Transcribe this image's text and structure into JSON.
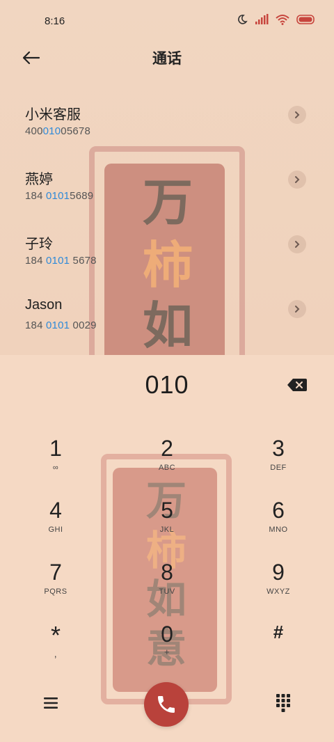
{
  "status_bar": {
    "time": "8:16",
    "icons": [
      "moon-icon",
      "signal-icon",
      "wifi-icon",
      "battery-icon"
    ]
  },
  "header": {
    "title": "通话",
    "back_icon": "arrow-left-icon"
  },
  "contacts": [
    {
      "name": "小米客服",
      "num_pre": "400",
      "num_hl": "010",
      "num_post": "05678"
    },
    {
      "name": "燕婷",
      "num_pre": "184 ",
      "num_hl": "0101",
      "num_post": "5689"
    },
    {
      "name": "子玲",
      "num_pre": "184 ",
      "num_hl": "0101",
      "num_post": " 5678"
    },
    {
      "name": "Jason",
      "num_pre": "184 ",
      "num_hl": "0101",
      "num_post": " 0029"
    }
  ],
  "dialer": {
    "number": "010",
    "keys": [
      {
        "digit": "1",
        "letters": "∞"
      },
      {
        "digit": "2",
        "letters": "ABC"
      },
      {
        "digit": "3",
        "letters": "DEF"
      },
      {
        "digit": "4",
        "letters": "GHI"
      },
      {
        "digit": "5",
        "letters": "JKL"
      },
      {
        "digit": "6",
        "letters": "MNO"
      },
      {
        "digit": "7",
        "letters": "PQRS"
      },
      {
        "digit": "8",
        "letters": "TUV"
      },
      {
        "digit": "9",
        "letters": "WXYZ"
      },
      {
        "digit": "*",
        "letters": ","
      },
      {
        "digit": "0",
        "letters": "+"
      },
      {
        "digit": "#",
        "letters": ""
      }
    ]
  },
  "wallpaper": {
    "line1": "万",
    "line2": "柿",
    "line3": "如",
    "line4": "意"
  },
  "colors": {
    "highlight": "#2f8ad9",
    "call_button": "#b9423b",
    "card": "#cd8f80"
  }
}
